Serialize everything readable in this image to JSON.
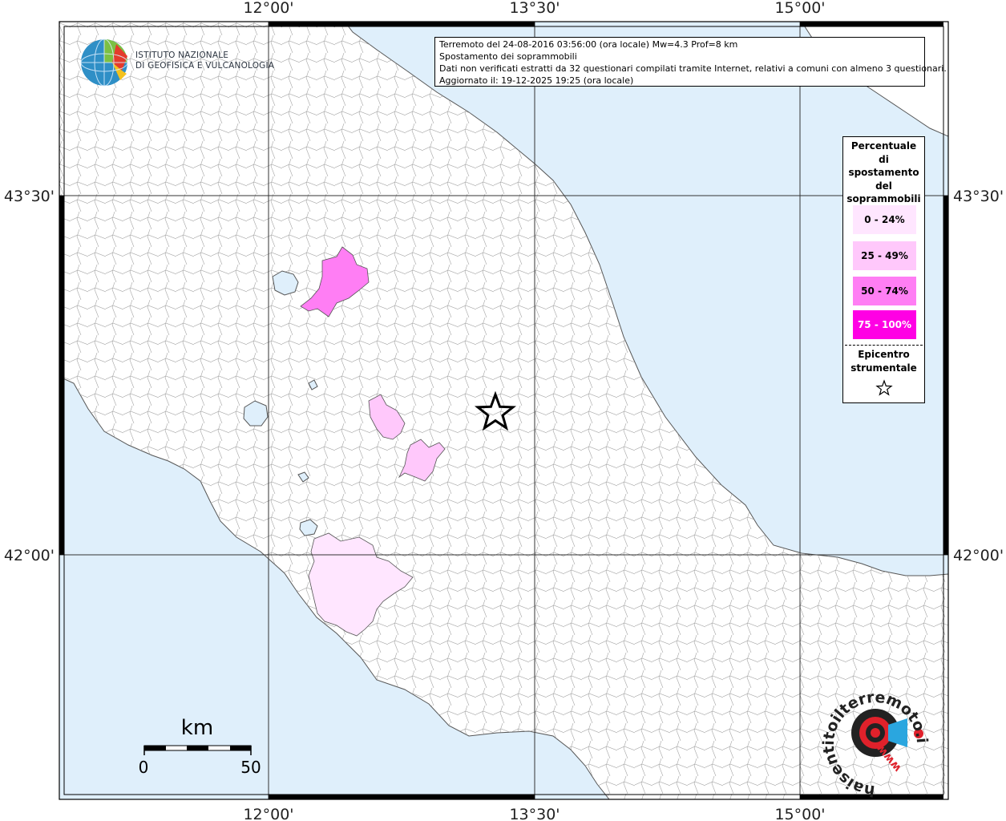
{
  "info_box": {
    "line1": "Terremoto del 24-08-2016 03:56:00 (ora locale) Mw=4.3 Prof=8 km",
    "line2": "Spostamento dei soprammobili",
    "line3": "Dati non verificati estratti da 32 questionari compilati tramite Internet, relativi a comuni con almeno 3 questionari.",
    "line4": "Aggiornato il: 19-12-2025 19:25 (ora locale)"
  },
  "institute": {
    "line1": "ISTITUTO NAZIONALE",
    "line2": "DI GEOFISICA E VULCANOLOGIA"
  },
  "axes": {
    "lon_labels": [
      "12°00'",
      "13°30'",
      "15°00'"
    ],
    "lat_labels": [
      "43°30'",
      "42°00'"
    ]
  },
  "legend": {
    "title": [
      "Percentuale",
      "di",
      "spostamento",
      "del",
      "soprammobili"
    ],
    "classes": [
      {
        "label": "0 - 24%",
        "color": "#ffe6ff"
      },
      {
        "label": "25 - 49%",
        "color": "#ffc8fb"
      },
      {
        "label": "50 - 74%",
        "color": "#ff7ef4"
      },
      {
        "label": "75 - 100%",
        "color": "#ff00e4"
      }
    ],
    "epicenter_label": [
      "Epicentro",
      "strumentale"
    ]
  },
  "scale_bar": {
    "unit": "km",
    "start": "0",
    "end": "50"
  },
  "colors": {
    "sea": "#dfeffb",
    "land": "#ffffff",
    "boundaries": "#8a8a8a"
  },
  "icons": {
    "epicenter": "star-icon",
    "logo_ingv": "globe-logo-icon",
    "logo_hsit": "haisentitoilterremoto-logo-icon"
  },
  "brand": {
    "hsit_ring": "haisentitoilterremoto.it",
    "hsit_www": "www."
  }
}
